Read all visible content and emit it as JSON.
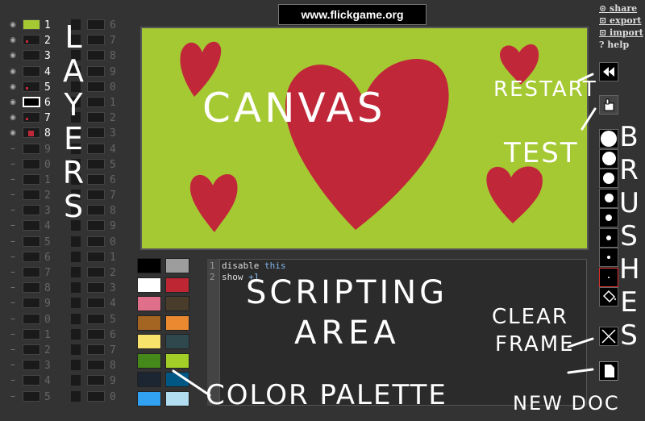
{
  "url": "www.flickgame.org",
  "menu": {
    "share": "share",
    "export": "export",
    "import": "import",
    "help": "? help"
  },
  "layers_col1": [
    "1",
    "2",
    "3",
    "4",
    "5",
    "6",
    "7",
    "8",
    "9",
    "0",
    "1",
    "2",
    "3",
    "4",
    "5",
    "6",
    "7",
    "8",
    "9",
    "0",
    "1",
    "2",
    "3",
    "4",
    "5"
  ],
  "layers_col2": [
    "6",
    "7",
    "8",
    "9",
    "0",
    "1",
    "2",
    "3",
    "4",
    "5",
    "6",
    "7",
    "8",
    "9",
    "0",
    "1",
    "2",
    "3",
    "4",
    "5",
    "6",
    "7",
    "8",
    "9",
    "0"
  ],
  "palette": [
    "#000000",
    "#9d9d9d",
    "#ffffff",
    "#be2633",
    "#e06f8b",
    "#493c2b",
    "#a46422",
    "#eb8931",
    "#f7e26b",
    "#2f484e",
    "#44891a",
    "#a3ce27",
    "#1b2632",
    "#005784",
    "#31a2f2",
    "#b2dcef"
  ],
  "script": [
    {
      "n": "1",
      "kw1": "disable",
      "kw2": "this"
    },
    {
      "n": "2",
      "kw1": "show",
      "kw2": "+1"
    }
  ],
  "annotations": {
    "layers": "LAYERS",
    "canvas": "CANVAS",
    "restart": "RESTART",
    "test": "TEST",
    "brushes": "BRUSHES",
    "scripting": "SCRIPTING",
    "area": "AREA",
    "clear": "CLEAR",
    "frame": "FRAME",
    "palette": "COLOR PALETTE",
    "newdoc": "NEW DOC"
  }
}
